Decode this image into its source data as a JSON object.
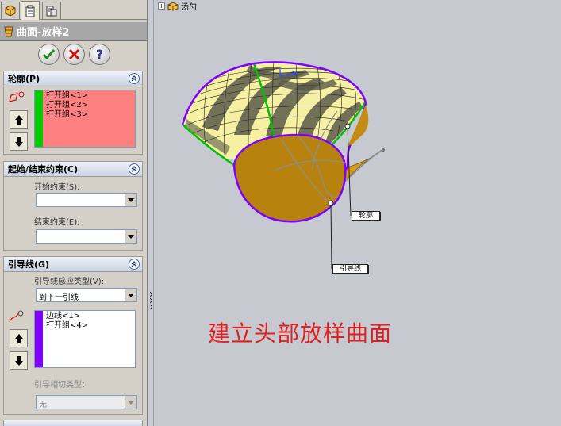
{
  "panel": {
    "tabs": [
      {
        "icon": "feature-manager-icon"
      },
      {
        "icon": "property-manager-icon"
      },
      {
        "icon": "configuration-manager-icon"
      }
    ],
    "title": "曲面-放样2",
    "ok_icon": "check-icon",
    "cancel_icon": "cancel-x-icon",
    "help_icon": "help-question-icon",
    "profiles": {
      "header": "轮廓(P)",
      "items": [
        "打开组<1>",
        "打开组<2>",
        "打开组<3>"
      ],
      "list_color": "#ff8080",
      "bar_color": "#00cc00"
    },
    "constraints": {
      "header": "起始/结束约束(C)",
      "start_label": "开始约束(S):",
      "start_value": "",
      "end_label": "结束约束(E):",
      "end_value": ""
    },
    "guides": {
      "header": "引导线(G)",
      "influence_label": "引导线感应类型(V):",
      "influence_value": "到下一引线",
      "items": [
        "边线<1>",
        "打开组<4>"
      ],
      "bar_color": "#8000ff",
      "tangency_label": "引导相切类型：",
      "tangency_value": "无"
    }
  },
  "viewport": {
    "tree_label": "汤勺",
    "callouts": {
      "profile": "轮廓",
      "guide": "引导线"
    },
    "caption": "建立头部放样曲面",
    "colors": {
      "surface": "#b8820e",
      "zebra_light": "#f6f0a2",
      "profile_edge": "#8000ff",
      "guide_edge": "#00c000",
      "caption": "#e02020"
    }
  }
}
